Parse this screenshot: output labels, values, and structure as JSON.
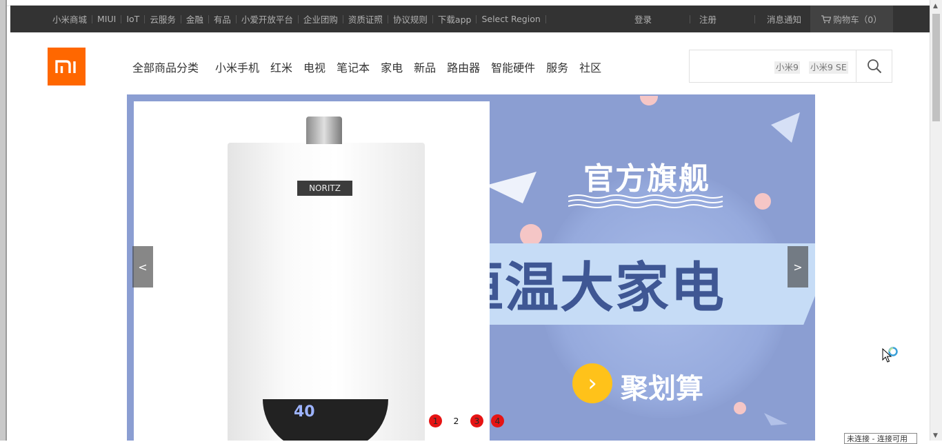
{
  "topbar": {
    "links": [
      "小米商城",
      "MIUI",
      "IoT",
      "云服务",
      "金融",
      "有品",
      "小爱开放平台",
      "企业团购",
      "资质证照",
      "协议规则",
      "下载app",
      "Select Region"
    ],
    "login": "登录",
    "register": "注册",
    "messages": "消息通知",
    "cart": "购物车（0）"
  },
  "header": {
    "logo_text": "mi",
    "nav": [
      "全部商品分类",
      "小米手机",
      "红米",
      "电视",
      "笔记本",
      "家电",
      "新品",
      "路由器",
      "智能硬件",
      "服务",
      "社区"
    ],
    "search": {
      "hot_words": [
        "小米9",
        "小米9 SE"
      ]
    }
  },
  "banner": {
    "brand": "NORITZ",
    "display_value": "40",
    "title_top": "官方旗舰",
    "title_main": "恒温大家电",
    "cta_text": "聚划算",
    "prev_label": "<",
    "next_label": ">",
    "pages": [
      "1",
      "2",
      "3",
      "4"
    ],
    "active_pages_red": [
      "1",
      "3",
      "4"
    ]
  },
  "status_tooltip": "未连接 - 连接可用",
  "colors": {
    "topbar_bg": "#333333",
    "accent": "#ff6700",
    "banner_bg": "#8b9ed2",
    "pager_red": "#e61414"
  }
}
